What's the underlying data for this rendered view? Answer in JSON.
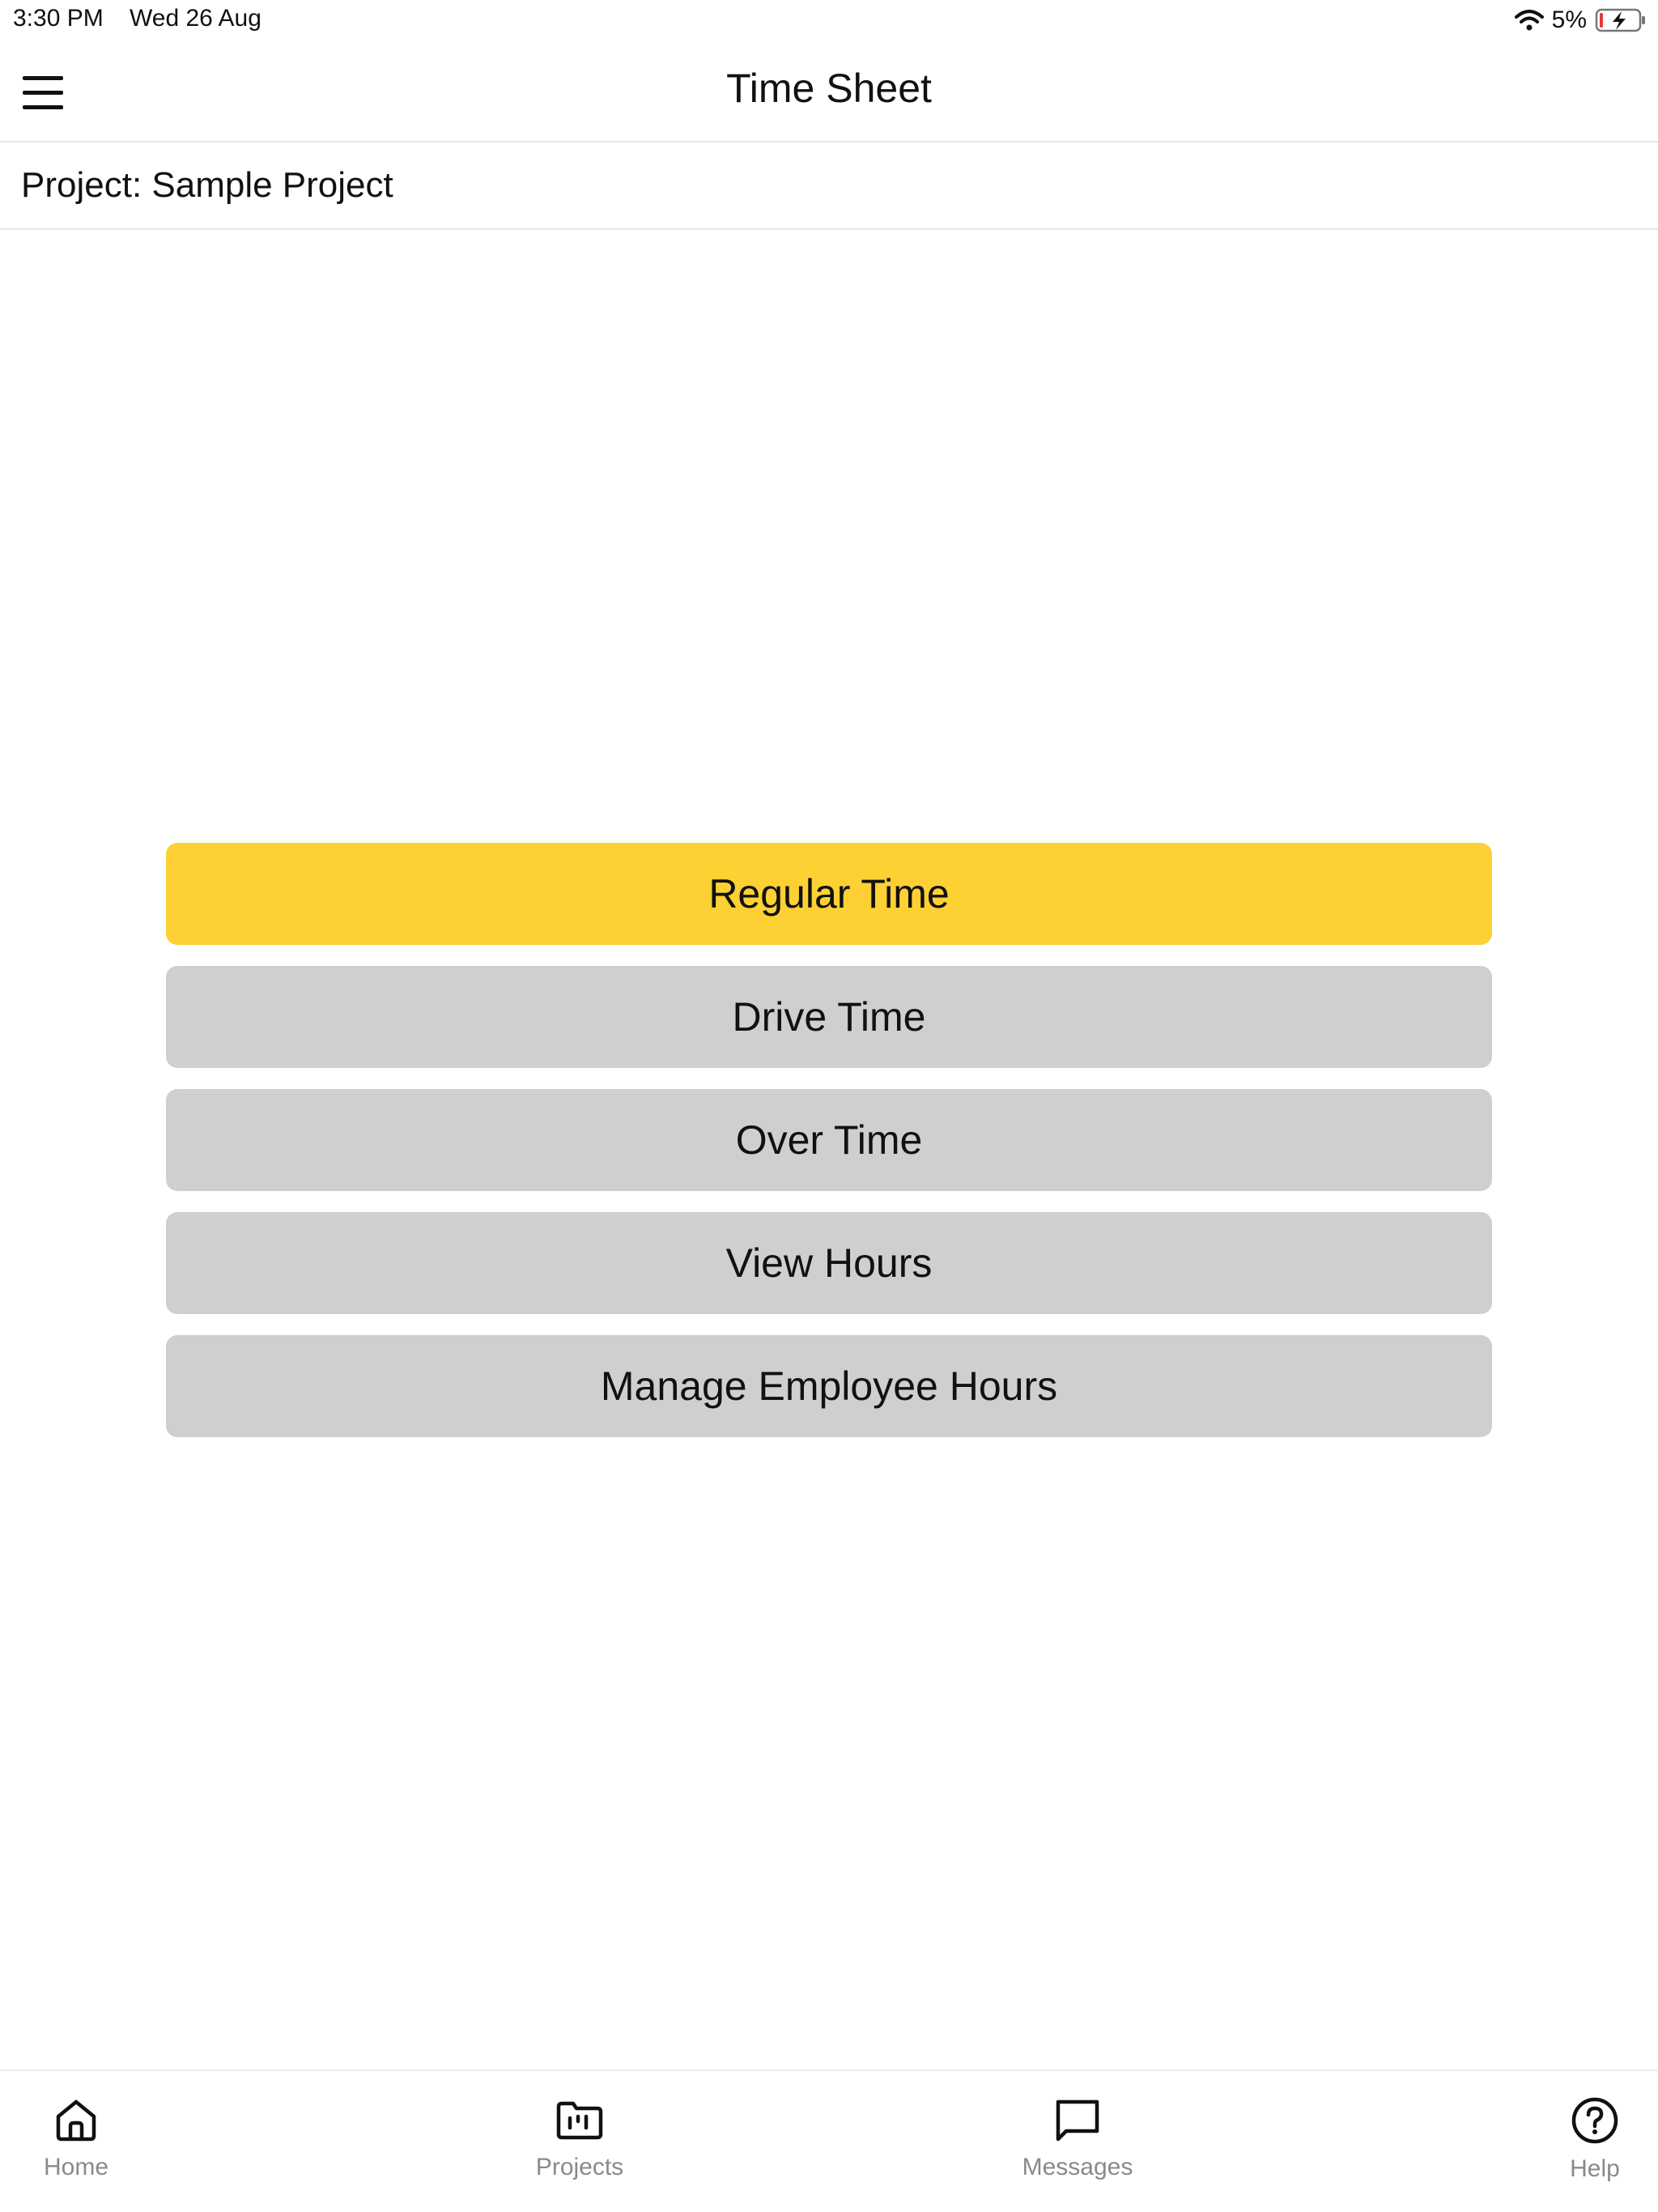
{
  "status_bar": {
    "time": "3:30 PM",
    "date": "Wed 26 Aug",
    "battery": "5%",
    "wifi_icon": "wifi-icon",
    "battery_icon": "battery-charging-icon"
  },
  "header": {
    "title": "Time Sheet",
    "menu_icon": "hamburger-menu-icon"
  },
  "project": {
    "label": "Project: Sample Project"
  },
  "actions": [
    {
      "label": "Regular Time",
      "selected": true,
      "color": "#FDD034"
    },
    {
      "label": "Drive Time",
      "selected": false,
      "color": "#CFCFCF"
    },
    {
      "label": "Over Time",
      "selected": false,
      "color": "#CFCFCF"
    },
    {
      "label": "View Hours",
      "selected": false,
      "color": "#CFCFCF"
    },
    {
      "label": "Manage Employee Hours",
      "selected": false,
      "color": "#CFCFCF"
    }
  ],
  "tab_bar": {
    "tabs": [
      {
        "label": "Home",
        "icon": "home-icon"
      },
      {
        "label": "Projects",
        "icon": "folder-icon"
      },
      {
        "label": "Messages",
        "icon": "message-icon"
      },
      {
        "label": "Help",
        "icon": "help-icon"
      }
    ]
  }
}
